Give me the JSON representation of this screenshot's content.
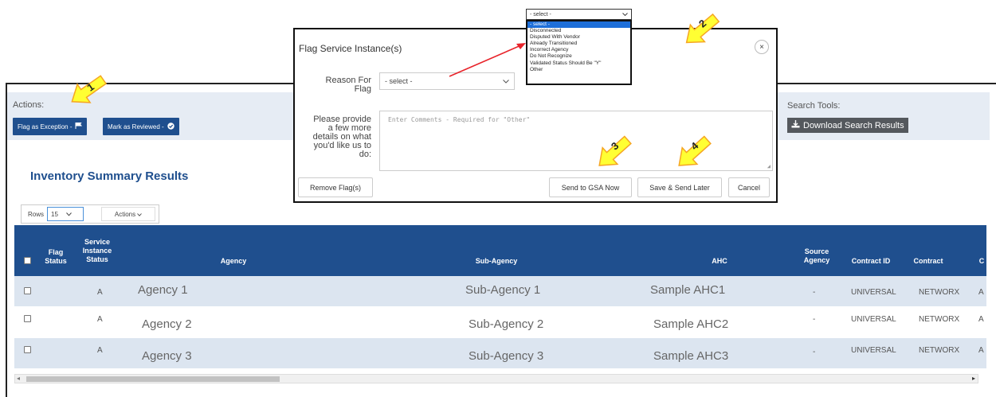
{
  "actions": {
    "label": "Actions:",
    "flag_btn": "Flag as Exception -",
    "reviewed_btn": "Mark as Reviewed -"
  },
  "search_tools": {
    "label": "Search Tools:",
    "download_btn": "Download Search Results"
  },
  "section_title": "Inventory Summary Results",
  "rows_control": {
    "label": "Rows",
    "value": "15",
    "actions": "Actions"
  },
  "table": {
    "headers": {
      "flag_status": "Flag Status",
      "service_instance_status": "Service Instance Status",
      "agency": "Agency",
      "sub_agency": "Sub-Agency",
      "ahc": "AHC",
      "source_agency": "Source Agency",
      "contract_id": "Contract ID",
      "contract": "Contract",
      "cut": "C"
    },
    "rows": [
      {
        "status": "A",
        "agency": "Agency 1",
        "sub_agency": "Sub-Agency 1",
        "ahc": "Sample AHC1",
        "source_agency": "-",
        "contract_id": "UNIVERSAL",
        "contract": "NETWORX",
        "cut": "A"
      },
      {
        "status": "A",
        "agency": "Agency 2",
        "sub_agency": "Sub-Agency 2",
        "ahc": "Sample AHC2",
        "source_agency": "-",
        "contract_id": "UNIVERSAL",
        "contract": "NETWORX",
        "cut": "A"
      },
      {
        "status": "A",
        "agency": "Agency 3",
        "sub_agency": "Sub-Agency 3",
        "ahc": "Sample AHC3",
        "source_agency": "-",
        "contract_id": "UNIVERSAL",
        "contract": "NETWORX",
        "cut": "A"
      }
    ]
  },
  "modal": {
    "title": "Flag Service Instance(s)",
    "close": "×",
    "reason_label_1": "Reason For",
    "reason_label_2": "Flag",
    "reason_value": "- select -",
    "details_label_1": "Please provide",
    "details_label_2": "a few more",
    "details_label_3": "details on what",
    "details_label_4": "you'd like us to",
    "details_label_5": "do:",
    "comments_placeholder": "Enter Comments - Required for \"Other\"",
    "remove_btn": "Remove Flag(s)",
    "send_now_btn": "Send to GSA Now",
    "save_later_btn": "Save & Send Later",
    "cancel_btn": "Cancel"
  },
  "dropdown": {
    "current": "- select -",
    "options": [
      "- select -",
      "Disconnected",
      "Disputed With Vendor",
      "Already Transitioned",
      "Incorrect Agency",
      "Do Not Recognize",
      "Validated Status Should Be \"Y\"",
      "Other"
    ]
  },
  "callouts": [
    "1",
    "2",
    "3",
    "4"
  ],
  "colors": {
    "primary": "#1f4f8e",
    "callout_fill": "#ffff33",
    "callout_stroke": "#f5a623",
    "pointer_arrow": "#e8232a"
  }
}
